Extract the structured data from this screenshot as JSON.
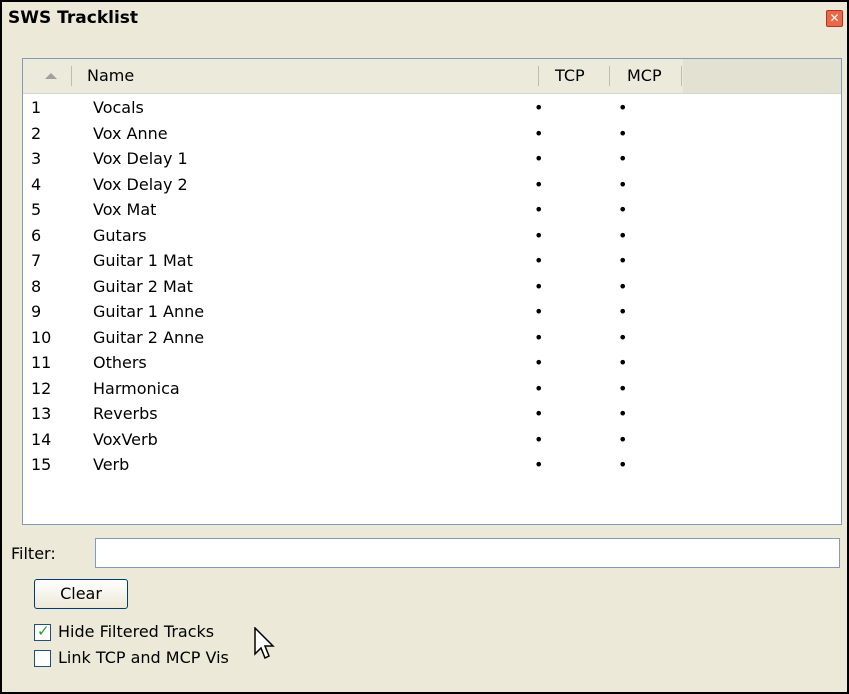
{
  "window": {
    "title": "SWS Tracklist",
    "close_glyph": "✕"
  },
  "columns": {
    "sort_icon": "sort-ascending-icon",
    "name": "Name",
    "tcp": "TCP",
    "mcp": "MCP"
  },
  "tracks": [
    {
      "num": "1",
      "name": "Vocals",
      "tcp": "•",
      "mcp": "•"
    },
    {
      "num": "2",
      "name": "Vox Anne",
      "tcp": "•",
      "mcp": "•"
    },
    {
      "num": "3",
      "name": "Vox Delay 1",
      "tcp": "•",
      "mcp": "•"
    },
    {
      "num": "4",
      "name": "Vox Delay 2",
      "tcp": "•",
      "mcp": "•"
    },
    {
      "num": "5",
      "name": "Vox Mat",
      "tcp": "•",
      "mcp": "•"
    },
    {
      "num": "6",
      "name": "Gutars",
      "tcp": "•",
      "mcp": "•"
    },
    {
      "num": "7",
      "name": "Guitar 1 Mat",
      "tcp": "•",
      "mcp": "•"
    },
    {
      "num": "8",
      "name": "Guitar 2 Mat",
      "tcp": "•",
      "mcp": "•"
    },
    {
      "num": "9",
      "name": "Guitar 1 Anne",
      "tcp": "•",
      "mcp": "•"
    },
    {
      "num": "10",
      "name": "Guitar 2 Anne",
      "tcp": "•",
      "mcp": "•"
    },
    {
      "num": "11",
      "name": "Others",
      "tcp": "•",
      "mcp": "•"
    },
    {
      "num": "12",
      "name": "Harmonica",
      "tcp": "•",
      "mcp": "•"
    },
    {
      "num": "13",
      "name": "Reverbs",
      "tcp": "•",
      "mcp": "•"
    },
    {
      "num": "14",
      "name": "VoxVerb",
      "tcp": "•",
      "mcp": "•"
    },
    {
      "num": "15",
      "name": "Verb",
      "tcp": "•",
      "mcp": "•"
    }
  ],
  "filter": {
    "label": "Filter:",
    "value": ""
  },
  "clear_button": "Clear",
  "options": {
    "hide_filtered": {
      "label": "Hide Filtered Tracks",
      "checked": true
    },
    "link_vis": {
      "label": "Link TCP and MCP Vis",
      "checked": false
    }
  },
  "colors": {
    "accent": "#21a121",
    "close": "#e8684a",
    "window_bg": "#ece9d8"
  }
}
